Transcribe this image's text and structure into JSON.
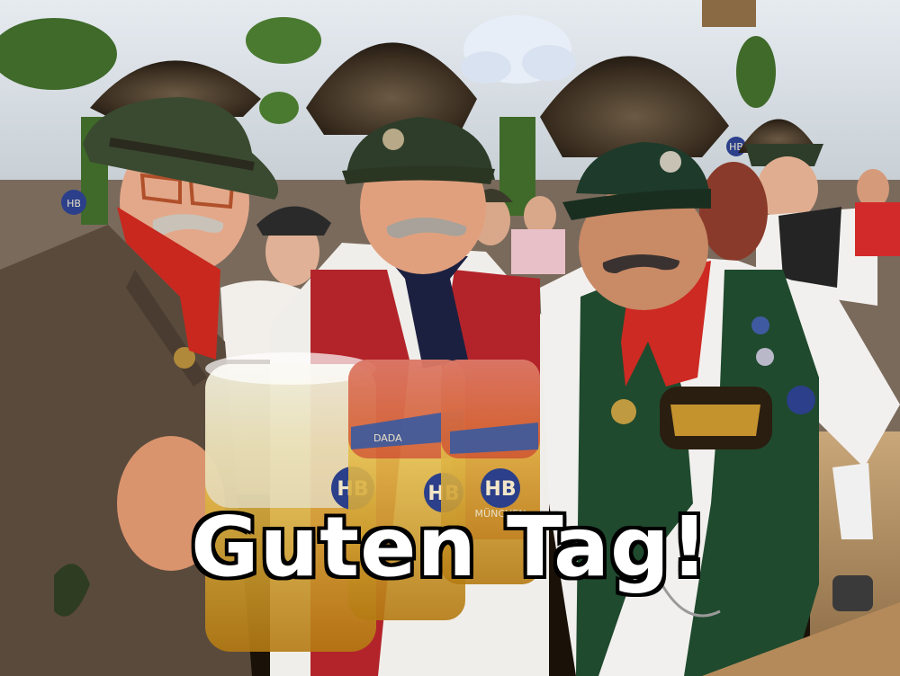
{
  "caption": {
    "text": "Guten Tag!"
  },
  "mug_branding": {
    "logo_letters": "HB",
    "city_text": "MÜNCHEN",
    "band_text": "DADA"
  },
  "palette": {
    "tent_ceiling": "#d9dfe6",
    "garland_green": "#3f6a2a",
    "jacket_brown": "#5a4a3c",
    "vest_red": "#b3242a",
    "vest_green": "#1f4a2e",
    "hat_green": "#2e3d2a",
    "beer_gold": "#e3b53c",
    "caption_fill": "#ffffff",
    "caption_outline": "#000000"
  }
}
